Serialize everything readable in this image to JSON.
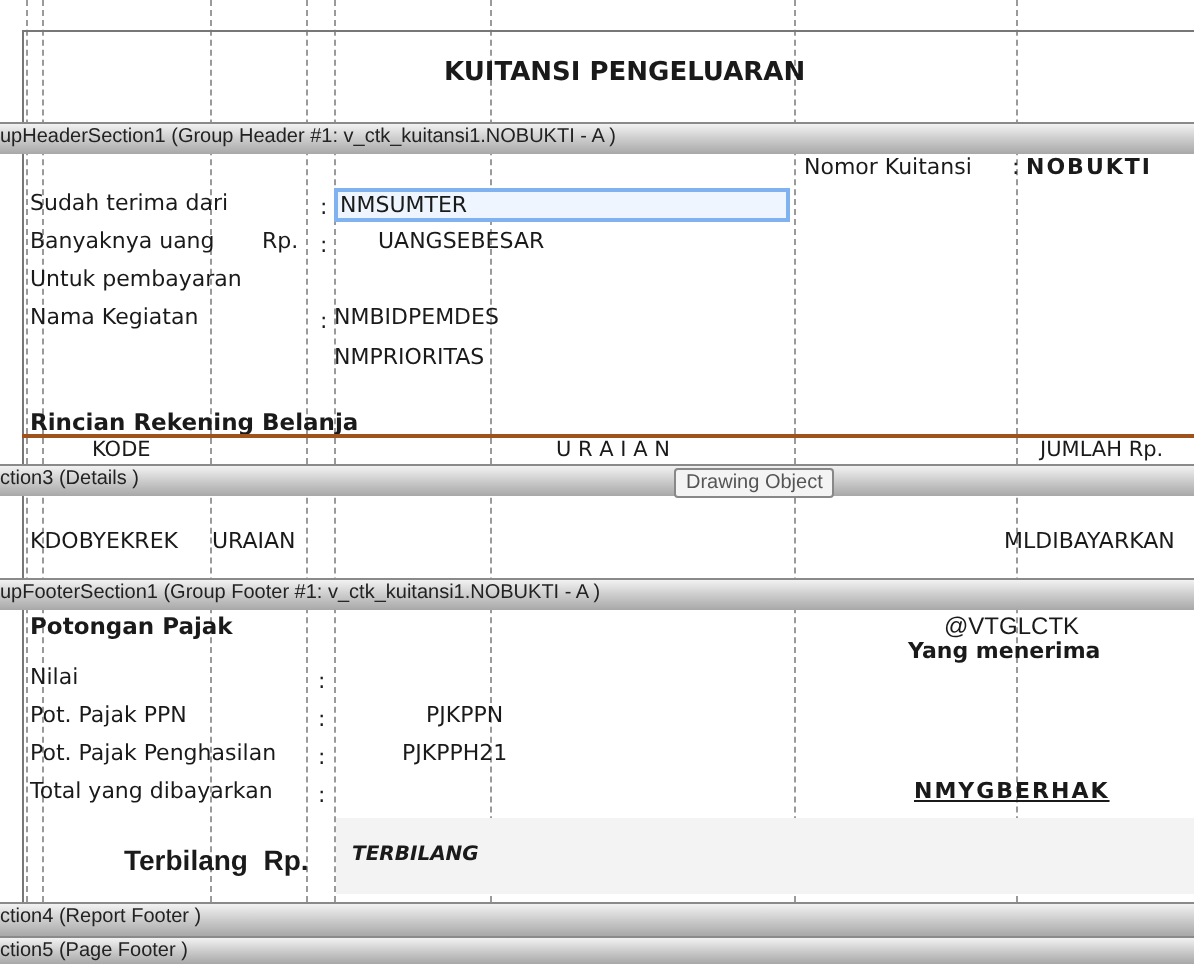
{
  "report_header": {
    "title": "KUITANSI PENGELUARAN"
  },
  "group_header": {
    "bar_label": "upHeaderSection1 (Group Header #1: v_ctk_kuitansi1.NOBUKTI - A )",
    "receipt_number": {
      "label": "Nomor Kuitansi",
      "colon": ":",
      "field": "NOBUKTI"
    },
    "rows": [
      {
        "label": "Sudah terima dari",
        "colon": ":",
        "field": "NMSUMTER",
        "selected": true
      },
      {
        "label": "Banyaknya uang",
        "prefix": "Rp.",
        "colon": ":",
        "field": "UANGSEBESAR",
        "selected": false
      },
      {
        "label": "Untuk pembayaran",
        "selected": false
      },
      {
        "label": "Nama Kegiatan",
        "colon": ":",
        "field": "NMBIDPEMDES",
        "selected": false
      },
      {
        "field": "NMPRIORITAS",
        "selected": false
      }
    ],
    "subtitle": "Rincian Rekening Belanja",
    "columns": [
      "KODE",
      "U R A I A N",
      "JUMLAH Rp."
    ]
  },
  "tooltip": "Drawing Object",
  "details": {
    "bar_label": "ction3 (Details )",
    "cells": [
      "KDOBYEKREK",
      "URAIAN",
      "MLDIBAYARKAN"
    ]
  },
  "group_footer": {
    "bar_label": "upFooterSection1 (Group Footer #1: v_ctk_kuitansi1.NOBUKTI - A )",
    "heading": "Potongan Pajak",
    "rows": [
      {
        "label": "Nilai",
        "colon": ":"
      },
      {
        "label": "Pot. Pajak PPN",
        "colon": ":",
        "field": "PJKPPN"
      },
      {
        "label": "Pot. Pajak Penghasilan",
        "colon": ":",
        "field": "PJKPPH21"
      },
      {
        "label": "Total yang dibayarkan",
        "colon": ":"
      }
    ],
    "date_field": "@VTGLCTK",
    "signature_caption": "Yang menerima",
    "signer_field": "NMYGBERHAK",
    "terbilang_label": "Terbilang  Rp.",
    "terbilang_field": "TERBILANG"
  },
  "report_footer": {
    "bar_label": "ction4 (Report Footer )"
  },
  "page_footer": {
    "bar_label": "ction5 (Page Footer )"
  }
}
